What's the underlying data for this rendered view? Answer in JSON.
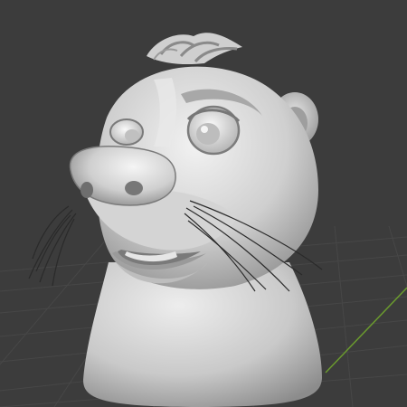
{
  "viewport": {
    "kind": "3d-viewport",
    "background_color": "#3c3c3c",
    "grid_color": "#4a4a4a",
    "y_axis_color": "#6a9a2e",
    "model": {
      "subject": "otter-head-sculpt",
      "material": "clay-grey",
      "base_color": "#dcdcdc",
      "shadow_color": "#8a8a8a"
    }
  }
}
